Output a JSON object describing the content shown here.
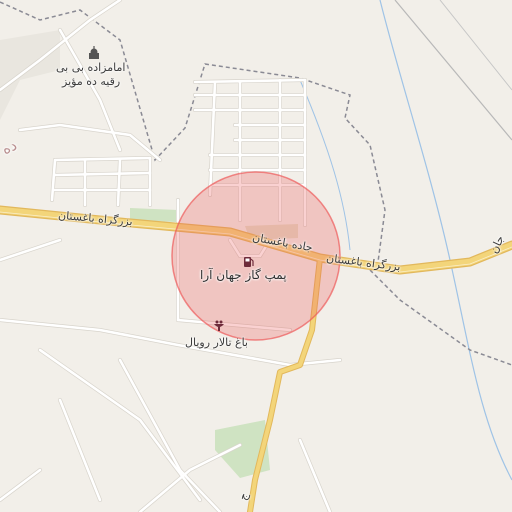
{
  "map": {
    "colors": {
      "background": "#f2efe9",
      "road_major": "#f3d57a",
      "road_major_casing": "#e2b85c",
      "road_minor": "#ffffff",
      "road_minor_casing": "#d8d4cc",
      "boundary": "#8a8a94",
      "water": "#9fc3e6",
      "park": "#cfe3c2",
      "sand": "#e3ddc6",
      "highlight": "#ee5a5a",
      "poi": "#6e2b3a"
    },
    "labels": {
      "village": "ده",
      "shrine": "امامزاده بی بی",
      "shrine_2": "رقیه ده مؤیز",
      "road_west": "بزرگراه باغستان",
      "road_center": "جاده باغستان",
      "road_east": "بزرگراه باغستان",
      "road_edge": "جان",
      "gas_station": "پمپ گاز جهان آرا",
      "hall": "باغ تالار رویال",
      "road_south": "ج"
    },
    "icons": {
      "shrine": "shrine-icon",
      "gas_station": "fuel-pump-icon",
      "hall": "venue-icon"
    }
  }
}
